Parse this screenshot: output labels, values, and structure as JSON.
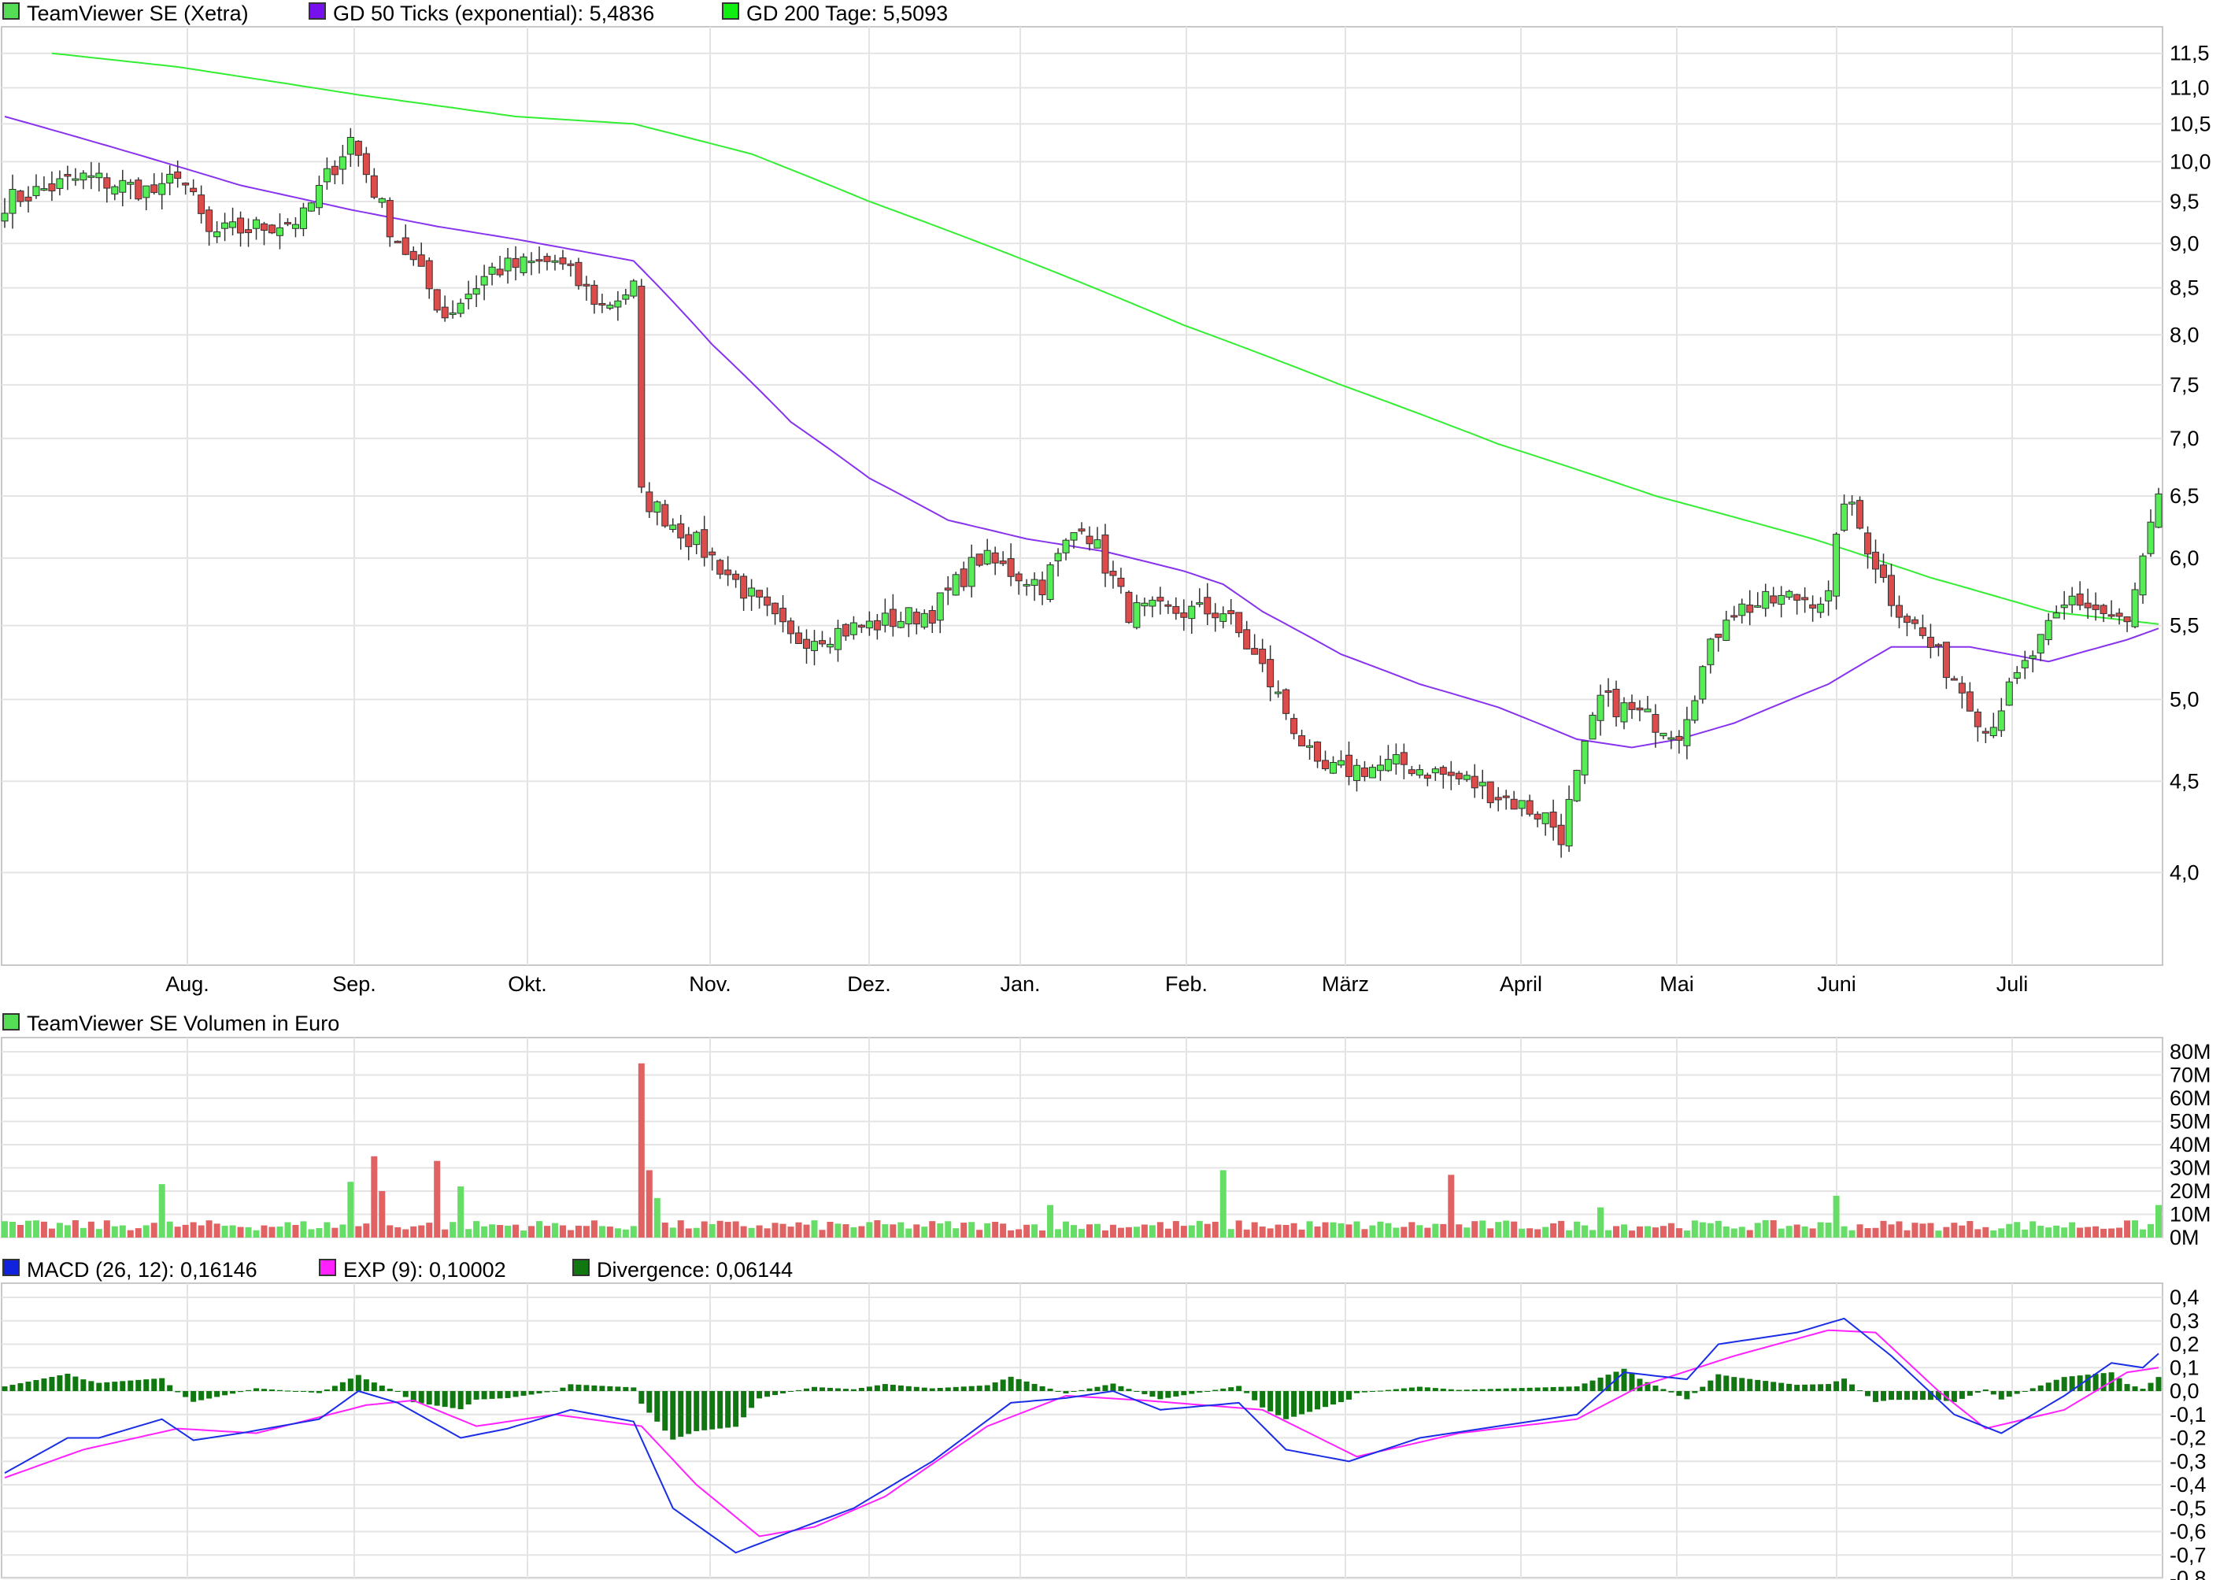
{
  "colors": {
    "up": "#55ee55",
    "down": "#dd4b4b",
    "candle_outline": "#333333",
    "ma50": "#8833ee",
    "ma200": "#33ee33",
    "macd": "#1a2ee6",
    "signal": "#ff22ff",
    "divergence": "#117711",
    "grid": "#e4e4e4"
  },
  "price_panel": {
    "legend": [
      {
        "label": "TeamViewer SE (Xetra)",
        "color": "#55dd55"
      },
      {
        "label": "GD 50 Ticks (exponential): 5,4836",
        "color": "#7711ee"
      },
      {
        "label": "GD 200 Tage: 5,5093",
        "color": "#11ee11"
      }
    ],
    "y_ticks": [
      "11,5",
      "11,0",
      "10,5",
      "10,0",
      "9,5",
      "9,0",
      "8,5",
      "8,0",
      "7,5",
      "7,0",
      "6,5",
      "6,0",
      "5,5",
      "5,0",
      "4,5",
      "4,0"
    ],
    "x_ticks": [
      "Aug.",
      "Sep.",
      "Okt.",
      "Nov.",
      "Dez.",
      "Jan.",
      "Feb.",
      "März",
      "April",
      "Mai",
      "Juni",
      "Juli"
    ]
  },
  "volume_panel": {
    "legend": [
      {
        "label": "TeamViewer SE Volumen in Euro",
        "color": "#55dd55"
      }
    ],
    "y_ticks": [
      "80M",
      "70M",
      "60M",
      "50M",
      "40M",
      "30M",
      "20M",
      "10M",
      "0M"
    ]
  },
  "macd_panel": {
    "legend": [
      {
        "label": "MACD (26, 12): 0,16146",
        "color": "#1122dd"
      },
      {
        "label": "EXP (9): 0,10002",
        "color": "#ff22ff"
      },
      {
        "label": "Divergence: 0,06144",
        "color": "#117711"
      }
    ],
    "y_ticks": [
      "0,4",
      "0,3",
      "0,2",
      "0,1",
      "0,0",
      "-0,1",
      "-0,2",
      "-0,3",
      "-0,4",
      "-0,5",
      "-0,6",
      "-0,7",
      "-0,8"
    ]
  },
  "chart_data": [
    {
      "type": "candlestick",
      "title": "TeamViewer SE (Xetra)",
      "y_scale": "log",
      "ylim": [
        3.55,
        11.9
      ],
      "x_labels": [
        "Aug.",
        "Sep.",
        "Okt.",
        "Nov.",
        "Dez.",
        "Jan.",
        "Feb.",
        "März",
        "April",
        "Mai",
        "Juni",
        "Juli"
      ],
      "close_anchors": [
        {
          "i": 0,
          "v": 9.5
        },
        {
          "i": 10,
          "v": 9.8
        },
        {
          "i": 20,
          "v": 9.6
        },
        {
          "i": 22,
          "v": 9.9
        },
        {
          "i": 26,
          "v": 9.1
        },
        {
          "i": 33,
          "v": 9.2
        },
        {
          "i": 38,
          "v": 9.3
        },
        {
          "i": 44,
          "v": 10.3
        },
        {
          "i": 49,
          "v": 9.2
        },
        {
          "i": 56,
          "v": 8.2
        },
        {
          "i": 62,
          "v": 8.7
        },
        {
          "i": 70,
          "v": 8.8
        },
        {
          "i": 76,
          "v": 8.3
        },
        {
          "i": 80,
          "v": 8.5
        },
        {
          "i": 81,
          "v": 6.5
        },
        {
          "i": 90,
          "v": 6.0
        },
        {
          "i": 100,
          "v": 5.4
        },
        {
          "i": 110,
          "v": 5.5
        },
        {
          "i": 118,
          "v": 5.6
        },
        {
          "i": 124,
          "v": 6.0
        },
        {
          "i": 132,
          "v": 5.8
        },
        {
          "i": 137,
          "v": 6.3
        },
        {
          "i": 143,
          "v": 5.6
        },
        {
          "i": 155,
          "v": 5.6
        },
        {
          "i": 160,
          "v": 5.2
        },
        {
          "i": 167,
          "v": 4.55
        },
        {
          "i": 178,
          "v": 4.6
        },
        {
          "i": 186,
          "v": 4.5
        },
        {
          "i": 196,
          "v": 4.3
        },
        {
          "i": 198,
          "v": 4.2
        },
        {
          "i": 203,
          "v": 5.0
        },
        {
          "i": 213,
          "v": 4.8
        },
        {
          "i": 219,
          "v": 5.6
        },
        {
          "i": 227,
          "v": 5.7
        },
        {
          "i": 232,
          "v": 5.7
        },
        {
          "i": 234,
          "v": 6.5
        },
        {
          "i": 240,
          "v": 5.7
        },
        {
          "i": 250,
          "v": 5.0
        },
        {
          "i": 252,
          "v": 4.8
        },
        {
          "i": 258,
          "v": 5.3
        },
        {
          "i": 263,
          "v": 5.7
        },
        {
          "i": 270,
          "v": 5.5
        },
        {
          "i": 274,
          "v": 6.45
        }
      ],
      "ma50_anchors": [
        {
          "i": 0,
          "v": 10.6
        },
        {
          "i": 10,
          "v": 10.3
        },
        {
          "i": 20,
          "v": 10.0
        },
        {
          "i": 30,
          "v": 9.7
        },
        {
          "i": 44,
          "v": 9.4
        },
        {
          "i": 55,
          "v": 9.2
        },
        {
          "i": 65,
          "v": 9.05
        },
        {
          "i": 80,
          "v": 8.8
        },
        {
          "i": 90,
          "v": 7.9
        },
        {
          "i": 100,
          "v": 7.15
        },
        {
          "i": 110,
          "v": 6.65
        },
        {
          "i": 120,
          "v": 6.3
        },
        {
          "i": 130,
          "v": 6.15
        },
        {
          "i": 140,
          "v": 6.05
        },
        {
          "i": 150,
          "v": 5.9
        },
        {
          "i": 155,
          "v": 5.8
        },
        {
          "i": 160,
          "v": 5.6
        },
        {
          "i": 170,
          "v": 5.3
        },
        {
          "i": 180,
          "v": 5.1
        },
        {
          "i": 190,
          "v": 4.95
        },
        {
          "i": 200,
          "v": 4.75
        },
        {
          "i": 207,
          "v": 4.7
        },
        {
          "i": 213,
          "v": 4.75
        },
        {
          "i": 220,
          "v": 4.85
        },
        {
          "i": 232,
          "v": 5.1
        },
        {
          "i": 240,
          "v": 5.35
        },
        {
          "i": 250,
          "v": 5.35
        },
        {
          "i": 260,
          "v": 5.25
        },
        {
          "i": 270,
          "v": 5.4
        },
        {
          "i": 274,
          "v": 5.48
        }
      ],
      "ma200_anchors": [
        {
          "i": 6,
          "v": 11.5
        },
        {
          "i": 22,
          "v": 11.3
        },
        {
          "i": 45,
          "v": 10.9
        },
        {
          "i": 65,
          "v": 10.6
        },
        {
          "i": 80,
          "v": 10.5
        },
        {
          "i": 95,
          "v": 10.1
        },
        {
          "i": 110,
          "v": 9.5
        },
        {
          "i": 130,
          "v": 8.8
        },
        {
          "i": 150,
          "v": 8.1
        },
        {
          "i": 170,
          "v": 7.5
        },
        {
          "i": 190,
          "v": 6.95
        },
        {
          "i": 210,
          "v": 6.5
        },
        {
          "i": 230,
          "v": 6.15
        },
        {
          "i": 245,
          "v": 5.85
        },
        {
          "i": 260,
          "v": 5.6
        },
        {
          "i": 274,
          "v": 5.51
        }
      ]
    },
    {
      "type": "bar",
      "title": "TeamViewer SE Volumen in Euro",
      "ylim": [
        0,
        80
      ],
      "unit": "M",
      "base_level": 5,
      "spikes": [
        {
          "i": 20,
          "v": 23
        },
        {
          "i": 44,
          "v": 24
        },
        {
          "i": 47,
          "v": 35
        },
        {
          "i": 48,
          "v": 20
        },
        {
          "i": 55,
          "v": 33
        },
        {
          "i": 58,
          "v": 22
        },
        {
          "i": 81,
          "v": 75
        },
        {
          "i": 82,
          "v": 29
        },
        {
          "i": 83,
          "v": 17
        },
        {
          "i": 133,
          "v": 14
        },
        {
          "i": 155,
          "v": 29
        },
        {
          "i": 184,
          "v": 27
        },
        {
          "i": 203,
          "v": 13
        },
        {
          "i": 233,
          "v": 18
        },
        {
          "i": 274,
          "v": 14
        }
      ]
    },
    {
      "type": "line",
      "title": "MACD",
      "ylim": [
        -0.8,
        0.4
      ],
      "macd_anchors": [
        {
          "i": 0,
          "v": -0.35
        },
        {
          "i": 8,
          "v": -0.2
        },
        {
          "i": 12,
          "v": -0.2
        },
        {
          "i": 20,
          "v": -0.12
        },
        {
          "i": 24,
          "v": -0.21
        },
        {
          "i": 30,
          "v": -0.18
        },
        {
          "i": 40,
          "v": -0.12
        },
        {
          "i": 45,
          "v": 0.0
        },
        {
          "i": 50,
          "v": -0.05
        },
        {
          "i": 58,
          "v": -0.2
        },
        {
          "i": 64,
          "v": -0.16
        },
        {
          "i": 72,
          "v": -0.08
        },
        {
          "i": 80,
          "v": -0.13
        },
        {
          "i": 85,
          "v": -0.5
        },
        {
          "i": 93,
          "v": -0.69
        },
        {
          "i": 100,
          "v": -0.6
        },
        {
          "i": 108,
          "v": -0.5
        },
        {
          "i": 118,
          "v": -0.3
        },
        {
          "i": 128,
          "v": -0.05
        },
        {
          "i": 135,
          "v": -0.03
        },
        {
          "i": 141,
          "v": 0.0
        },
        {
          "i": 147,
          "v": -0.08
        },
        {
          "i": 157,
          "v": -0.05
        },
        {
          "i": 163,
          "v": -0.25
        },
        {
          "i": 171,
          "v": -0.3
        },
        {
          "i": 180,
          "v": -0.2
        },
        {
          "i": 190,
          "v": -0.15
        },
        {
          "i": 200,
          "v": -0.1
        },
        {
          "i": 206,
          "v": 0.08
        },
        {
          "i": 214,
          "v": 0.05
        },
        {
          "i": 218,
          "v": 0.2
        },
        {
          "i": 228,
          "v": 0.25
        },
        {
          "i": 234,
          "v": 0.31
        },
        {
          "i": 240,
          "v": 0.15
        },
        {
          "i": 248,
          "v": -0.1
        },
        {
          "i": 254,
          "v": -0.18
        },
        {
          "i": 262,
          "v": -0.02
        },
        {
          "i": 268,
          "v": 0.12
        },
        {
          "i": 272,
          "v": 0.1
        },
        {
          "i": 274,
          "v": 0.16
        }
      ],
      "signal_anchors": [
        {
          "i": 0,
          "v": -0.37
        },
        {
          "i": 10,
          "v": -0.25
        },
        {
          "i": 22,
          "v": -0.16
        },
        {
          "i": 32,
          "v": -0.18
        },
        {
          "i": 46,
          "v": -0.06
        },
        {
          "i": 52,
          "v": -0.04
        },
        {
          "i": 60,
          "v": -0.15
        },
        {
          "i": 70,
          "v": -0.1
        },
        {
          "i": 81,
          "v": -0.15
        },
        {
          "i": 88,
          "v": -0.4
        },
        {
          "i": 96,
          "v": -0.62
        },
        {
          "i": 103,
          "v": -0.58
        },
        {
          "i": 112,
          "v": -0.45
        },
        {
          "i": 125,
          "v": -0.15
        },
        {
          "i": 135,
          "v": -0.02
        },
        {
          "i": 145,
          "v": -0.04
        },
        {
          "i": 160,
          "v": -0.08
        },
        {
          "i": 172,
          "v": -0.28
        },
        {
          "i": 185,
          "v": -0.18
        },
        {
          "i": 200,
          "v": -0.12
        },
        {
          "i": 208,
          "v": 0.02
        },
        {
          "i": 220,
          "v": 0.15
        },
        {
          "i": 232,
          "v": 0.26
        },
        {
          "i": 238,
          "v": 0.25
        },
        {
          "i": 246,
          "v": 0.0
        },
        {
          "i": 252,
          "v": -0.16
        },
        {
          "i": 262,
          "v": -0.08
        },
        {
          "i": 270,
          "v": 0.08
        },
        {
          "i": 274,
          "v": 0.1
        }
      ]
    }
  ]
}
